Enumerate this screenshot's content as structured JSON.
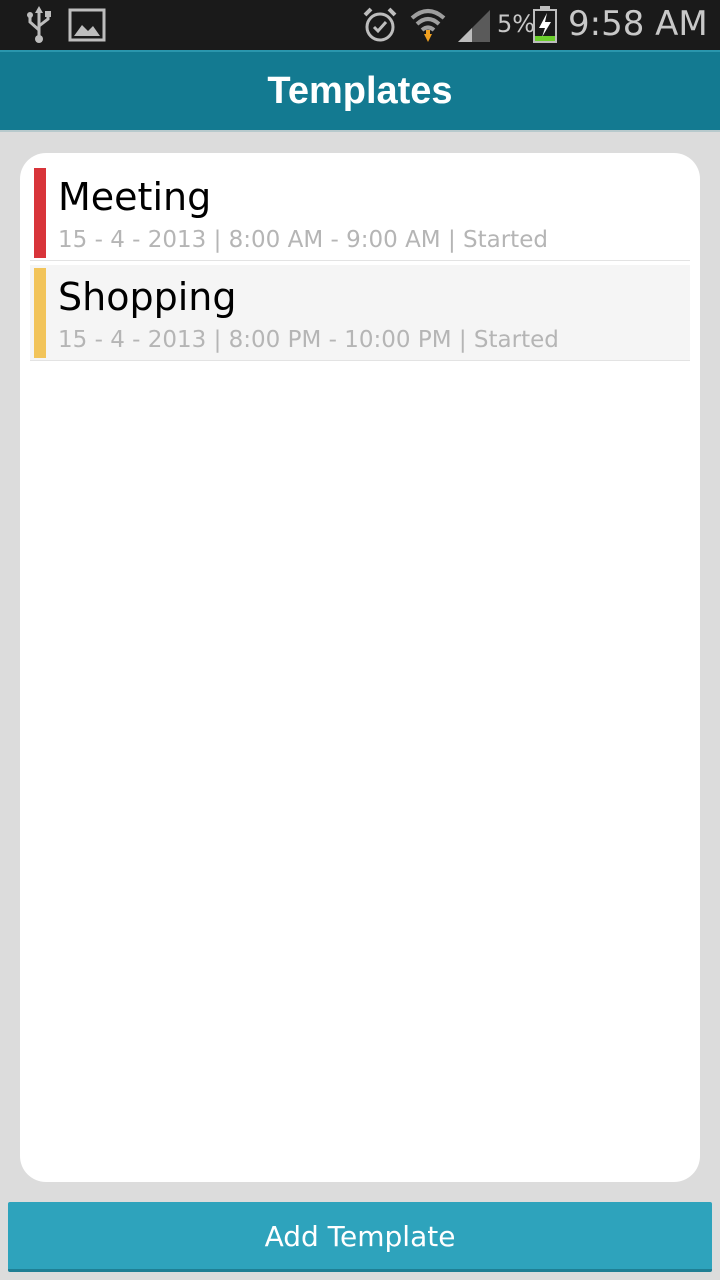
{
  "status_bar": {
    "battery_percent": "5%",
    "time": "9:58 AM",
    "icons": [
      "usb-icon",
      "gallery-icon",
      "alarm-icon",
      "wifi-icon",
      "signal-icon",
      "battery-charging-icon"
    ]
  },
  "header": {
    "title": "Templates",
    "color": "#137a91"
  },
  "templates": [
    {
      "title": "Meeting",
      "details": "15 - 4 - 2013 | 8:00 AM - 9:00 AM | Started",
      "color": "#d8343a"
    },
    {
      "title": "Shopping",
      "details": "15 - 4 - 2013 | 8:00 PM - 10:00 PM | Started",
      "color": "#f2c45a"
    }
  ],
  "footer": {
    "add_label": "Add Template",
    "color": "#2ea3bc"
  }
}
